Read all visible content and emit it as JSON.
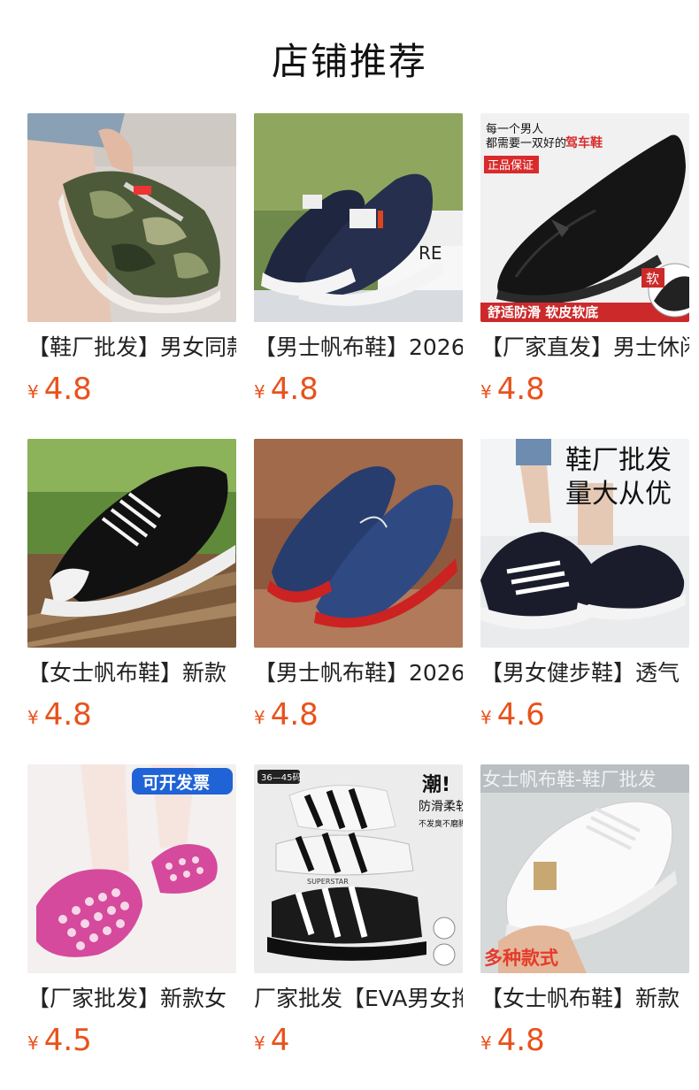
{
  "header": {
    "title": "店铺推荐"
  },
  "currency_symbol": "¥",
  "products": [
    {
      "name": "【鞋厂批发】男女同款",
      "price": "4.8",
      "image": "camo-sneaker"
    },
    {
      "name": "【男士帆布鞋】2026",
      "price": "4.8",
      "image": "navy-slipon"
    },
    {
      "name": "【厂家直发】男士休闲",
      "price": "4.8",
      "image": "black-leather-loafer",
      "image_text": {
        "line1": "每一个男人",
        "line2": "都需要一双好的",
        "highlight": "驾车鞋",
        "badge": "正品保证",
        "bottom": "舒适防滑  软皮软底",
        "corner": "软"
      }
    },
    {
      "name": "【女士帆布鞋】新款",
      "price": "4.8",
      "image": "black-canvas-sneaker"
    },
    {
      "name": "【男士帆布鞋】2026",
      "price": "4.8",
      "image": "denim-slipon"
    },
    {
      "name": "【男女健步鞋】透气",
      "price": "4.6",
      "image": "walking-shoe",
      "image_text": {
        "line1": "鞋厂批发",
        "line2": "量大从优"
      }
    },
    {
      "name": "【厂家批发】新款女",
      "price": "4.5",
      "image": "pink-hollow-shoe",
      "image_text": {
        "badge": "可开发票"
      }
    },
    {
      "name": "厂家批发【EVA男女拖",
      "price": "4",
      "image": "eva-slides",
      "image_text": {
        "size": "36—45码",
        "tag": "潮!",
        "v1": "防滑柔软",
        "v2": "不发臭不磨脚",
        "brand": "SUPERSTAR"
      }
    },
    {
      "name": "【女士帆布鞋】新款",
      "price": "4.8",
      "image": "white-canvas-sneaker",
      "image_text": {
        "top": "女士帆布鞋-鞋厂批发",
        "bottom": "多种款式"
      }
    }
  ]
}
